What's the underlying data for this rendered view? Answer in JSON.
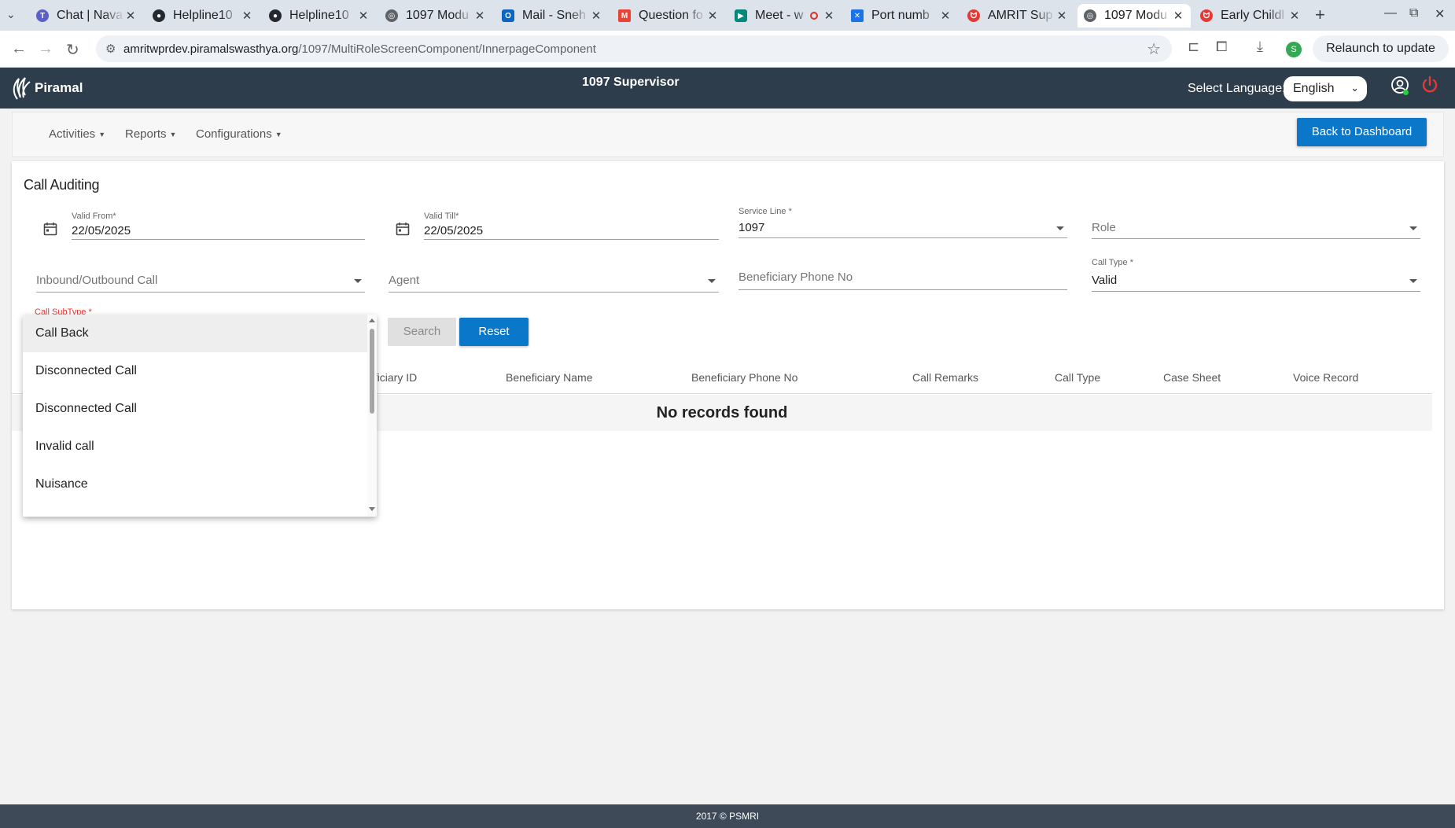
{
  "browser": {
    "tabs": [
      {
        "title": "Chat | Nava",
        "color": "#5b5fc7",
        "glyph": "T"
      },
      {
        "title": "Helpline10",
        "color": "#24292f",
        "glyph": "G"
      },
      {
        "title": "Helpline10",
        "color": "#24292f",
        "glyph": "G"
      },
      {
        "title": "1097 Modu",
        "color": "#5f6368",
        "glyph": "◎"
      },
      {
        "title": "Mail - Sneh",
        "color": "#0a66c2",
        "glyph": "O"
      },
      {
        "title": "Question fo",
        "color": "#ea4335",
        "glyph": "M"
      },
      {
        "title": "Meet - w",
        "color": "#00897b",
        "glyph": "▶"
      },
      {
        "title": "Port numb",
        "color": "#1a73e8",
        "glyph": "✕"
      },
      {
        "title": "AMRIT Sup",
        "color": "#e53935",
        "glyph": "ᗢ"
      },
      {
        "title": "1097 Modu",
        "color": "#5f6368",
        "glyph": "◎"
      },
      {
        "title": "Early Childl",
        "color": "#e53935",
        "glyph": "ᗢ"
      }
    ],
    "url_host": "amritwprdev.piramalswasthya.org",
    "url_path": "/1097/MultiRoleScreenComponent/InnerpageComponent",
    "relaunch_label": "Relaunch to update",
    "profile_initial": "S"
  },
  "header": {
    "logo_text": "Piramal",
    "title": "1097 Supervisor",
    "language_label": "Select Language:",
    "language_value": "English"
  },
  "menu": {
    "activities": "Activities",
    "reports": "Reports",
    "configurations": "Configurations",
    "back_button": "Back to Dashboard"
  },
  "form": {
    "title": "Call Auditing",
    "valid_from_label": "Valid From*",
    "valid_from_value": "22/05/2025",
    "valid_till_label": "Valid Till*",
    "valid_till_value": "22/05/2025",
    "service_line_label": "Service Line *",
    "service_line_value": "1097",
    "role_placeholder": "Role",
    "inout_placeholder": "Inbound/Outbound Call",
    "agent_placeholder": "Agent",
    "phone_placeholder": "Beneficiary Phone No",
    "call_type_label": "Call Type *",
    "call_type_value": "Valid",
    "call_subtype_label": "Call SubType *",
    "search_button": "Search",
    "reset_button": "Reset"
  },
  "table": {
    "headers": [
      "eficiary ID",
      "Beneficiary Name",
      "Beneficiary Phone No",
      "Call Remarks",
      "Call Type",
      "Case Sheet",
      "Voice Record"
    ],
    "empty_message": "No records found"
  },
  "dropdown": {
    "options": [
      "Call Back",
      "Disconnected Call",
      "Disconnected Call",
      "Invalid call",
      "Nuisance"
    ],
    "highlighted_index": 0
  },
  "footer": {
    "text": "2017 © PSMRI"
  },
  "colors": {
    "header_bg": "#2e3d4c",
    "primary_button": "#0a77c9",
    "required_label": "#e53935"
  }
}
